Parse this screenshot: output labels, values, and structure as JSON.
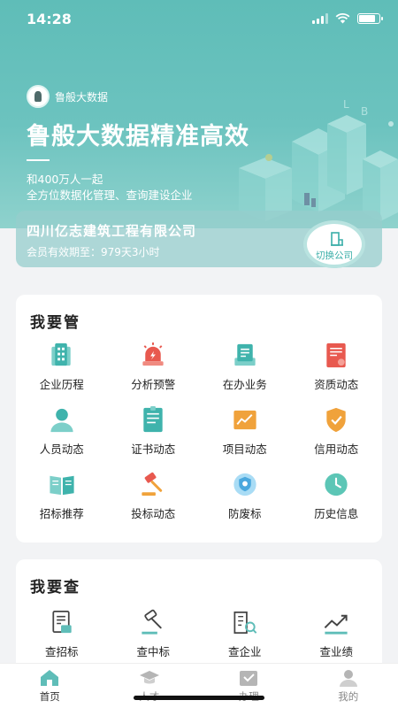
{
  "status_bar": {
    "time": "14:28"
  },
  "hero": {
    "brand_name": "鲁般大数据",
    "title": "鲁般大数据精准高效",
    "subtitle_line1": "和400万人一起",
    "subtitle_line2": "全方位数据化管理、查询建设企业"
  },
  "company": {
    "name": "四川亿志建筑工程有限公司",
    "expiry": "会员有效期至：979天3小时",
    "switch_label": "切换公司"
  },
  "manage": {
    "title": "我要管",
    "items": [
      {
        "label": "企业历程",
        "icon": "building-icon"
      },
      {
        "label": "分析预警",
        "icon": "alarm-icon"
      },
      {
        "label": "在办业务",
        "icon": "document-stack-icon"
      },
      {
        "label": "资质动态",
        "icon": "certificate-icon"
      },
      {
        "label": "人员动态",
        "icon": "person-icon"
      },
      {
        "label": "证书动态",
        "icon": "certificate-list-icon"
      },
      {
        "label": "项目动态",
        "icon": "chart-folder-icon"
      },
      {
        "label": "信用动态",
        "icon": "shield-check-icon"
      },
      {
        "label": "招标推荐",
        "icon": "open-book-icon"
      },
      {
        "label": "投标动态",
        "icon": "gavel-icon"
      },
      {
        "label": "防废标",
        "icon": "badge-shield-icon"
      },
      {
        "label": "历史信息",
        "icon": "clock-icon"
      }
    ]
  },
  "query": {
    "title": "我要查",
    "items": [
      {
        "label": "查招标",
        "icon": "bid-document-icon"
      },
      {
        "label": "查中标",
        "icon": "gavel-outline-icon"
      },
      {
        "label": "查企业",
        "icon": "company-search-icon"
      },
      {
        "label": "查业绩",
        "icon": "trend-chart-icon"
      }
    ]
  },
  "tabbar": {
    "tabs": [
      {
        "label": "首页",
        "icon": "home-icon"
      },
      {
        "label": "人才",
        "icon": "graduation-cap-icon"
      },
      {
        "label": "办理",
        "icon": "inbox-icon"
      },
      {
        "label": "我的",
        "icon": "user-icon"
      }
    ]
  },
  "colors": {
    "accent": "#5fbdb8",
    "alert": "#e8594f",
    "warning": "#f0a23b"
  }
}
